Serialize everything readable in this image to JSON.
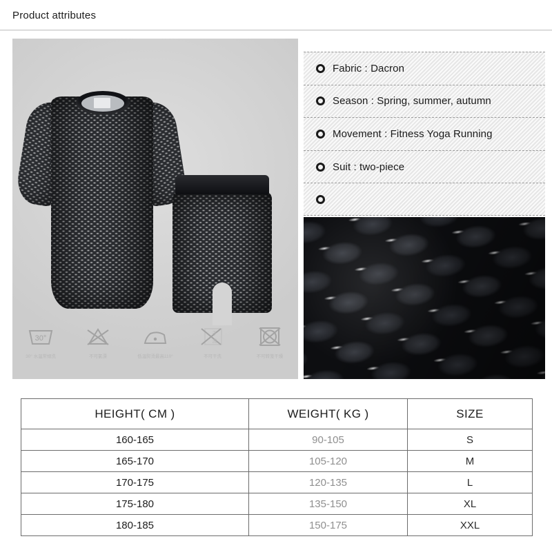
{
  "page": {
    "title": "Product attributes"
  },
  "attributes": {
    "items": [
      {
        "bullet": "ring-bullet-icon",
        "text": "Fabric : Dacron"
      },
      {
        "bullet": "ring-bullet-icon",
        "text": "Season : Spring, summer, autumn"
      },
      {
        "bullet": "ring-bullet-icon",
        "text": "Movement : Fitness Yoga Running"
      },
      {
        "bullet": "ring-bullet-icon",
        "text": "Suit : two-piece"
      },
      {
        "bullet": "ring-bullet-icon",
        "text": ""
      }
    ]
  },
  "care_symbols": [
    {
      "icon": "wash-tub-30-icon",
      "temp": "30°",
      "caption": "30° 水温常规洗"
    },
    {
      "icon": "no-bleach-icon",
      "temp": "",
      "caption": "不可氯漂"
    },
    {
      "icon": "iron-low-heat-icon",
      "temp": "",
      "caption": "低温熨烫最高110°"
    },
    {
      "icon": "no-dry-clean-icon",
      "temp": "",
      "caption": "不可干洗"
    },
    {
      "icon": "no-tumble-dry-icon",
      "temp": "",
      "caption": "不可转笼干燥"
    }
  ],
  "size_table": {
    "headers": [
      "HEIGHT( CM )",
      "WEIGHT( KG )",
      "SIZE"
    ],
    "rows": [
      {
        "height": "160-165",
        "weight": "90-105",
        "size": "S"
      },
      {
        "height": "165-170",
        "weight": "105-120",
        "size": "M"
      },
      {
        "height": "170-175",
        "weight": "120-135",
        "size": "L"
      },
      {
        "height": "175-180",
        "weight": "135-150",
        "size": "XL"
      },
      {
        "height": "180-185",
        "weight": "150-175",
        "size": "XXL"
      }
    ]
  },
  "colors": {
    "photo_background": "#d6d6d6",
    "attr_panel_background": "#ececec",
    "text_primary": "#1c1c1c",
    "text_muted": "#8f8f8f",
    "table_border": "#6b6b6b"
  }
}
